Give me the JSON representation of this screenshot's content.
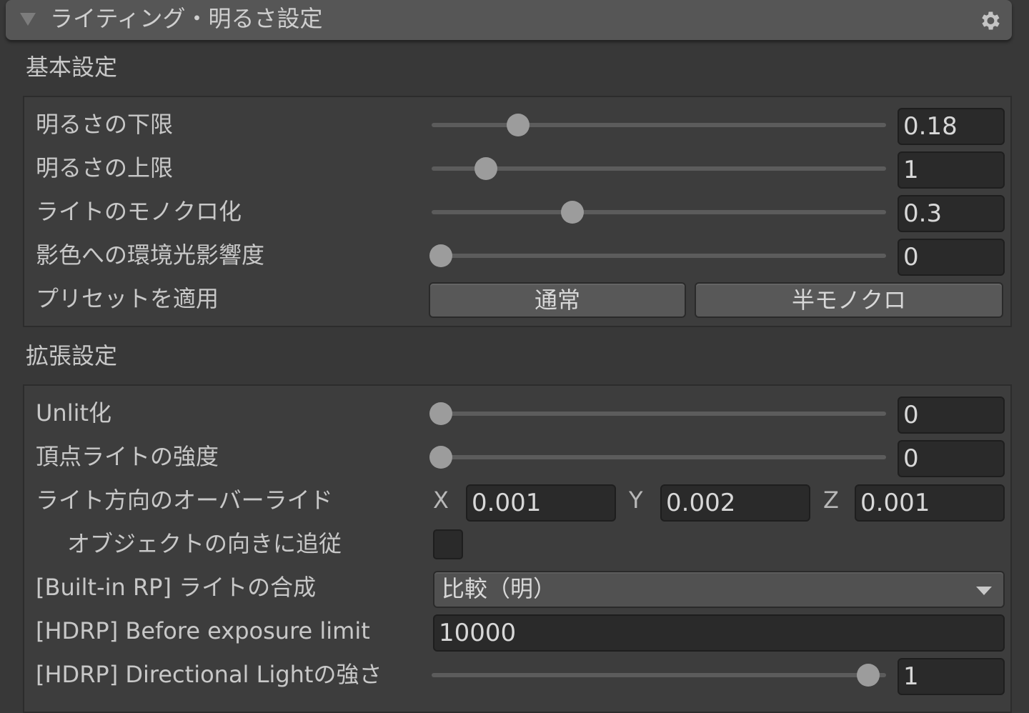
{
  "header": {
    "title": "ライティング・明るさ設定",
    "icons": {
      "collapse": "triangle-down-icon",
      "settings": "gear-icon"
    }
  },
  "basic": {
    "title": "基本設定",
    "rows": [
      {
        "label": "明るさの下限",
        "value": "0.18",
        "slider_fraction": 0.19
      },
      {
        "label": "明るさの上限",
        "value": "1",
        "slider_fraction": 0.12
      },
      {
        "label": "ライトのモノクロ化",
        "value": "0.3",
        "slider_fraction": 0.31
      },
      {
        "label": "影色への環境光影響度",
        "value": "0",
        "slider_fraction": 0.02
      }
    ],
    "preset": {
      "label": "プリセットを適用",
      "buttons": [
        "通常",
        "半モノクロ"
      ]
    }
  },
  "advanced": {
    "title": "拡張設定",
    "unlit": {
      "label": "Unlit化",
      "value": "0",
      "slider_fraction": 0.02
    },
    "vertex_light": {
      "label": "頂点ライトの強度",
      "value": "0",
      "slider_fraction": 0.02
    },
    "light_direction": {
      "label": "ライト方向のオーバーライド",
      "x_label": "X",
      "x": "0.001",
      "y_label": "Y",
      "y": "0.002",
      "z_label": "Z",
      "z": "0.001"
    },
    "follow_object": {
      "label": "オブジェクトの向きに追従",
      "checked": false
    },
    "builtin_blend": {
      "label": "[Built-in RP] ライトの合成",
      "selected": "比較（明）"
    },
    "hdrp_exposure": {
      "label": "[HDRP] Before exposure limit",
      "value": "10000"
    },
    "hdrp_directional": {
      "label": "[HDRP] Directional Lightの強さ",
      "value": "1",
      "slider_fraction": 0.96
    }
  },
  "colors": {
    "background": "#383838",
    "header": "#565656",
    "field": "#2a2a2a",
    "button": "#585858"
  }
}
